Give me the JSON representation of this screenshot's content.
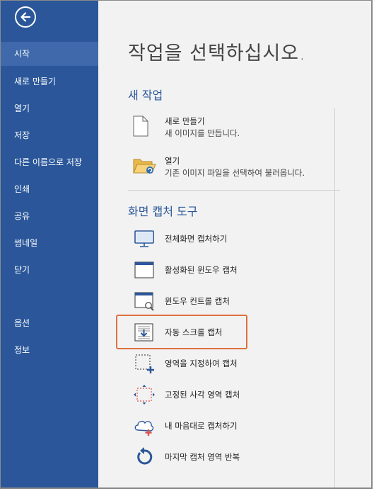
{
  "sidebar": {
    "items": [
      {
        "label": "시작"
      },
      {
        "label": "새로 만들기"
      },
      {
        "label": "열기"
      },
      {
        "label": "저장"
      },
      {
        "label": "다른 이름으로 저장"
      },
      {
        "label": "인쇄"
      },
      {
        "label": "공유"
      },
      {
        "label": "썸네일"
      },
      {
        "label": "닫기"
      },
      {
        "label": "옵션"
      },
      {
        "label": "정보"
      }
    ]
  },
  "main": {
    "title": "작업을 선택하십시오.",
    "new_section": {
      "title": "새 작업",
      "items": [
        {
          "title": "새로 만들기",
          "desc": "새 이미지를 만듭니다."
        },
        {
          "title": "열기",
          "desc": "기존 이미지 파일을 선택하여 불러옵니다."
        }
      ]
    },
    "capture_section": {
      "title": "화면 캡처 도구",
      "tools": [
        {
          "label": "전체화면 캡처하기"
        },
        {
          "label": "활성화된 윈도우 캡처"
        },
        {
          "label": "윈도우 컨트롤 캡처"
        },
        {
          "label": "자동 스크롤 캡처"
        },
        {
          "label": "영역을 지정하여 캡처"
        },
        {
          "label": "고정된 사각 영역 캡처"
        },
        {
          "label": "내 마음대로 캡처하기"
        },
        {
          "label": "마지막 캡처 영역 반복"
        }
      ]
    }
  },
  "colors": {
    "sidebar": "#2b579a",
    "sidebar_active": "#3f69ab",
    "accent": "#2b579a",
    "highlight": "#e0703f"
  }
}
